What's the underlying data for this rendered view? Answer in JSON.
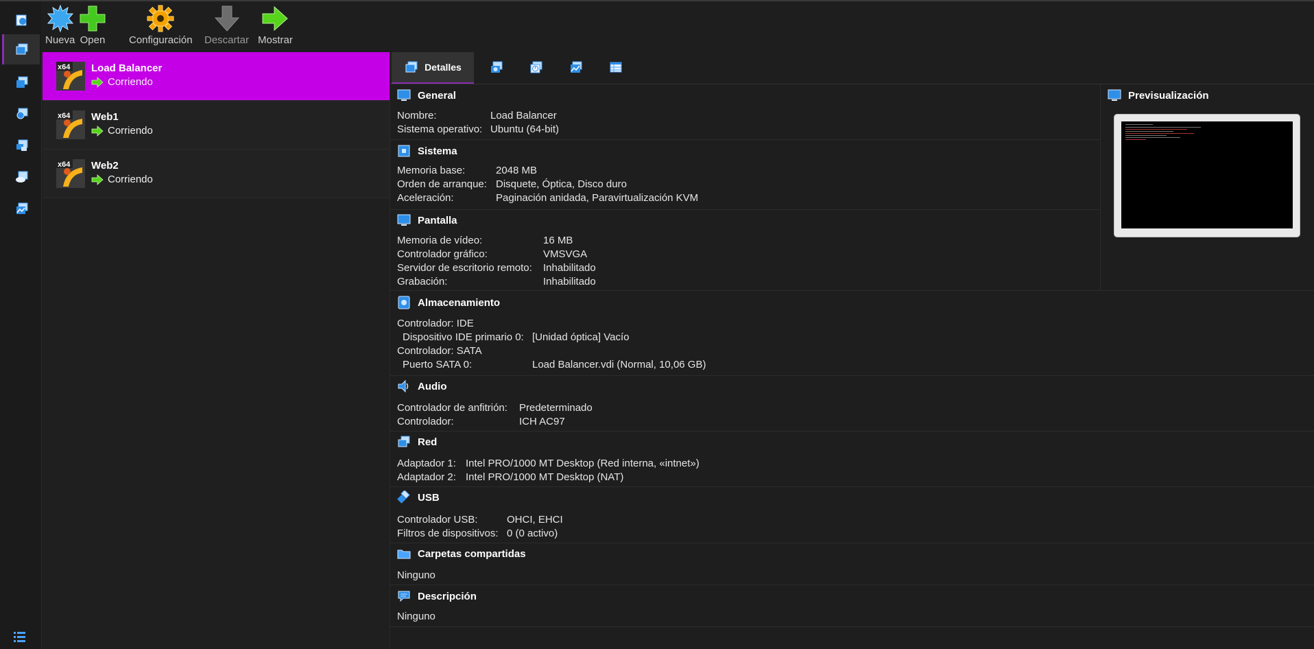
{
  "toolbar": {
    "new_label": "Nueva",
    "open_label": "Open",
    "settings_label": "Configuración",
    "discard_label": "Descartar",
    "show_label": "Mostrar"
  },
  "vms": [
    {
      "name": "Load Balancer",
      "state": "Corriendo",
      "os_badge": "x64"
    },
    {
      "name": "Web1",
      "state": "Corriendo",
      "os_badge": "x64"
    },
    {
      "name": "Web2",
      "state": "Corriendo",
      "os_badge": "x64"
    }
  ],
  "tabs": {
    "details_label": "Detalles"
  },
  "general": {
    "title": "General",
    "rows": [
      {
        "label": "Nombre:",
        "value": "Load Balancer"
      },
      {
        "label": "Sistema operativo:",
        "value": "Ubuntu (64-bit)"
      }
    ]
  },
  "system": {
    "title": "Sistema",
    "rows": [
      {
        "label": "Memoria base:",
        "value": "2048 MB"
      },
      {
        "label": "Orden de arranque:",
        "value": "Disquete, Óptica, Disco duro"
      },
      {
        "label": "Aceleración:",
        "value": "Paginación anidada, Paravirtualización KVM"
      }
    ]
  },
  "display": {
    "title": "Pantalla",
    "rows": [
      {
        "label": "Memoria de vídeo:",
        "value": "16 MB"
      },
      {
        "label": "Controlador gráfico:",
        "value": "VMSVGA"
      },
      {
        "label": "Servidor de escritorio remoto:",
        "value": "Inhabilitado"
      },
      {
        "label": "Grabación:",
        "value": "Inhabilitado"
      }
    ]
  },
  "storage": {
    "title": "Almacenamiento",
    "rows": [
      {
        "label": "Controlador: IDE",
        "value": ""
      },
      {
        "label": " Dispositivo IDE primario 0:",
        "value": "[Unidad óptica] Vacío"
      },
      {
        "label": "Controlador: SATA",
        "value": ""
      },
      {
        "label": " Puerto SATA 0:",
        "value": "Load Balancer.vdi (Normal, 10,06 GB)"
      }
    ]
  },
  "audio": {
    "title": "Audio",
    "rows": [
      {
        "label": "Controlador de anfitrión:",
        "value": "Predeterminado"
      },
      {
        "label": "Controlador:",
        "value": "ICH AC97"
      }
    ]
  },
  "network": {
    "title": "Red",
    "rows": [
      {
        "label": "Adaptador 1:",
        "value": "Intel PRO/1000 MT Desktop (Red interna, «intnet»)"
      },
      {
        "label": "Adaptador 2:",
        "value": "Intel PRO/1000 MT Desktop (NAT)"
      }
    ]
  },
  "usb": {
    "title": "USB",
    "rows": [
      {
        "label": "Controlador USB:",
        "value": "OHCI, EHCI"
      },
      {
        "label": "Filtros de dispositivos:",
        "value": "0 (0 activo)"
      }
    ]
  },
  "shared": {
    "title": "Carpetas compartidas",
    "value": "Ninguno"
  },
  "description": {
    "title": "Descripción",
    "value": "Ninguno"
  },
  "preview": {
    "title": "Previsualización"
  },
  "colors": {
    "selection": "#c400e6",
    "accent": "#8a2db0",
    "running_arrow": "#57d41c"
  }
}
